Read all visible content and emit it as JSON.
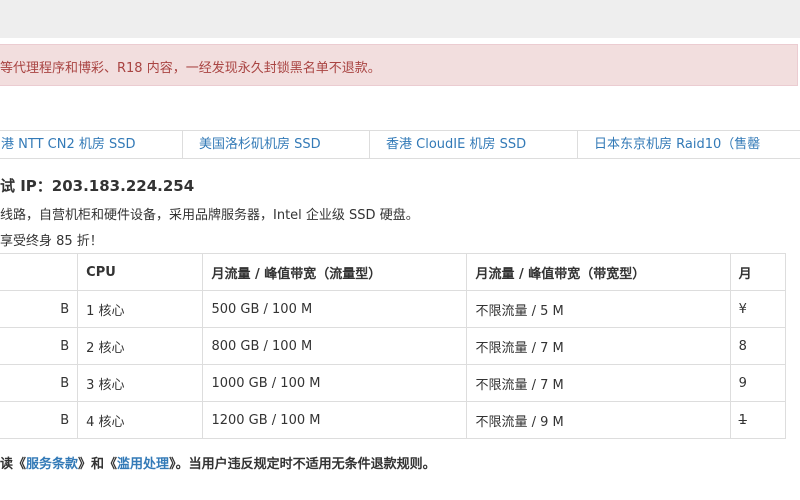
{
  "alert": {
    "text": "等代理程序和博彩、R18 内容，一经发现永久封锁黑名单不退款。"
  },
  "tabs": [
    {
      "label": "港 NTT CN2 机房 SSD"
    },
    {
      "label": "美国洛杉矶机房 SSD"
    },
    {
      "label": "香港 CloudIE 机房 SSD"
    },
    {
      "label": "日本东京机房 Raid10（售罄"
    }
  ],
  "info": {
    "title": "试 IP：203.183.224.254",
    "desc": "线路，自营机柜和硬件设备，采用品牌服务器，Intel 企业级 SSD 硬盘。",
    "promo": "享受终身 85 折！"
  },
  "table": {
    "headers": [
      "",
      "CPU",
      "月流量 / 峰值带宽（流量型）",
      "月流量 / 峰值带宽（带宽型）",
      "月"
    ],
    "rows": [
      [
        "B",
        "1 核心",
        "500 GB / 100 M",
        "不限流量 / 5 M",
        "¥"
      ],
      [
        "B",
        "2 核心",
        "800 GB / 100 M",
        "不限流量 / 7 M",
        "8"
      ],
      [
        "B",
        "3 核心",
        "1000 GB / 100 M",
        "不限流量 / 7 M",
        "9"
      ],
      [
        "B",
        "4 核心",
        "1200 GB / 100 M",
        "不限流量 / 9 M",
        "1"
      ]
    ]
  },
  "notice": {
    "prefix": "读《",
    "terms_link": "服务条款",
    "middle": "》和《",
    "abuse_link": "滥用处理",
    "suffix": "》。当用户违反规定时不适用无条件退款规则。"
  }
}
